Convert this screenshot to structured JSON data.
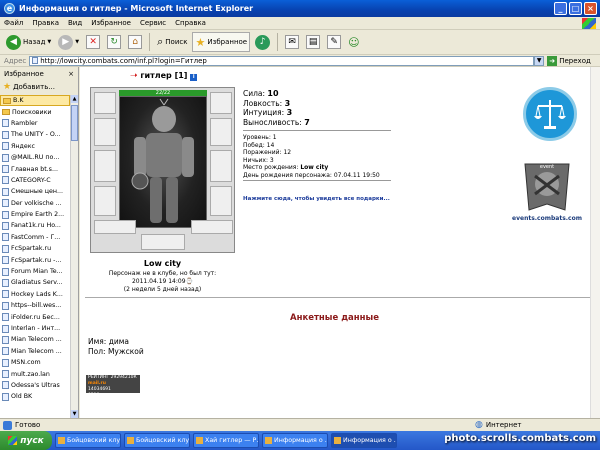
{
  "window": {
    "title": "Информация о гитлер - Microsoft Internet Explorer"
  },
  "menu": [
    "Файл",
    "Правка",
    "Вид",
    "Избранное",
    "Сервис",
    "Справка"
  ],
  "toolbar": {
    "back": "Назад",
    "search": "Поиск",
    "favorites": "Избранное"
  },
  "address": {
    "label": "Адрес",
    "url": "http://lowcity.combats.com/inf.pl?login=Гитлер",
    "go": "Переход"
  },
  "favorites": {
    "title": "Избранное",
    "close": "×",
    "add": "Добавить...",
    "items": [
      {
        "label": "B.K",
        "type": "folder",
        "selected": true
      },
      {
        "label": "Поисковики",
        "type": "folder"
      },
      {
        "label": "Rambler",
        "type": "page"
      },
      {
        "label": "The UNITY - O...",
        "type": "page"
      },
      {
        "label": "Яндекс",
        "type": "page"
      },
      {
        "label": "@MAIL.RU по...",
        "type": "page"
      },
      {
        "label": "Главная  bt.s...",
        "type": "page"
      },
      {
        "label": "CATEGORY-C",
        "type": "page"
      },
      {
        "label": "Смешные цен...",
        "type": "page"
      },
      {
        "label": "Der volkische ...",
        "type": "page"
      },
      {
        "label": "Empire Earth 2...",
        "type": "page"
      },
      {
        "label": "Fanat1k.ru Ho...",
        "type": "page"
      },
      {
        "label": "FastComm - Г...",
        "type": "page"
      },
      {
        "label": "FcSpartak.ru",
        "type": "page"
      },
      {
        "label": "FcSpartak.ru -...",
        "type": "page"
      },
      {
        "label": "Forum Mian Te...",
        "type": "page"
      },
      {
        "label": "Gladiatus Serv...",
        "type": "page"
      },
      {
        "label": "Hockey Lads K...",
        "type": "page"
      },
      {
        "label": "https--bill.wes...",
        "type": "page"
      },
      {
        "label": "iFolder.ru Бес...",
        "type": "page"
      },
      {
        "label": "Interlan - Инт...",
        "type": "page"
      },
      {
        "label": "Mian Telecom ...",
        "type": "page"
      },
      {
        "label": "Mian Telecom ...",
        "type": "page"
      },
      {
        "label": "MSN.com",
        "type": "page"
      },
      {
        "label": "mult.zao.lan",
        "type": "page"
      },
      {
        "label": "Odessa's Ultras",
        "type": "page"
      },
      {
        "label": "Old BK",
        "type": "page"
      }
    ]
  },
  "character": {
    "name": "гитлер",
    "level": "[1]",
    "hp": "22/22",
    "location": "Low city",
    "status_line1": "Персонаж не в клубе, но был тут:",
    "status_line2": "2011.04.19 14:09",
    "status_line3": "(2 недели 5 дней назад)",
    "stats": [
      {
        "label": "Сила:",
        "value": "10"
      },
      {
        "label": "Ловкость:",
        "value": "3"
      },
      {
        "label": "Интуиция:",
        "value": "3"
      },
      {
        "label": "Выносливость:",
        "value": "7"
      }
    ],
    "details": [
      {
        "label": "Уровень:",
        "value": "1"
      },
      {
        "label": "Побед:",
        "value": "14"
      },
      {
        "label": "Поражений:",
        "value": "12"
      },
      {
        "label": "Ничьих:",
        "value": "3"
      },
      {
        "label": "Место рождения:",
        "value": "Low city",
        "bold": true
      },
      {
        "label": "День рождения персонажа:",
        "value": "07.04.11 19:50"
      }
    ],
    "gifts_link": "Нажмите сюда, чтобы увидеть все подарки...",
    "events_label": "events.combats.com",
    "events_tag": "event",
    "emblem_icon": "scales-icon"
  },
  "profile": {
    "section_title": "Анкетные данные",
    "name_label": "Имя:",
    "name_value": "дима",
    "gender_label": "Пол:",
    "gender_value": "Мужской"
  },
  "counter": {
    "line1": "РЕЙТИНГ 29294210К",
    "line2": "mail.ru",
    "line3": "14034691",
    "line4": "0219"
  },
  "statusbar": {
    "text": "Готово",
    "zone": "Интернет"
  },
  "taskbar": {
    "start": "пуск",
    "tasks": [
      {
        "label": "Бойцовский клу...",
        "active": false
      },
      {
        "label": "Бойцовский клу...",
        "active": false
      },
      {
        "label": "Хай гитлер — Р...",
        "active": false
      },
      {
        "label": "Информация о ...",
        "active": false
      },
      {
        "label": "Информация о ...",
        "active": true
      }
    ]
  },
  "watermark": "photo.scrolls.combats.com",
  "colors": {
    "accent": "#8b1a1a",
    "link": "#1a3a9a",
    "emblem": "#1e97d8",
    "hp": "#2a9a2a"
  }
}
